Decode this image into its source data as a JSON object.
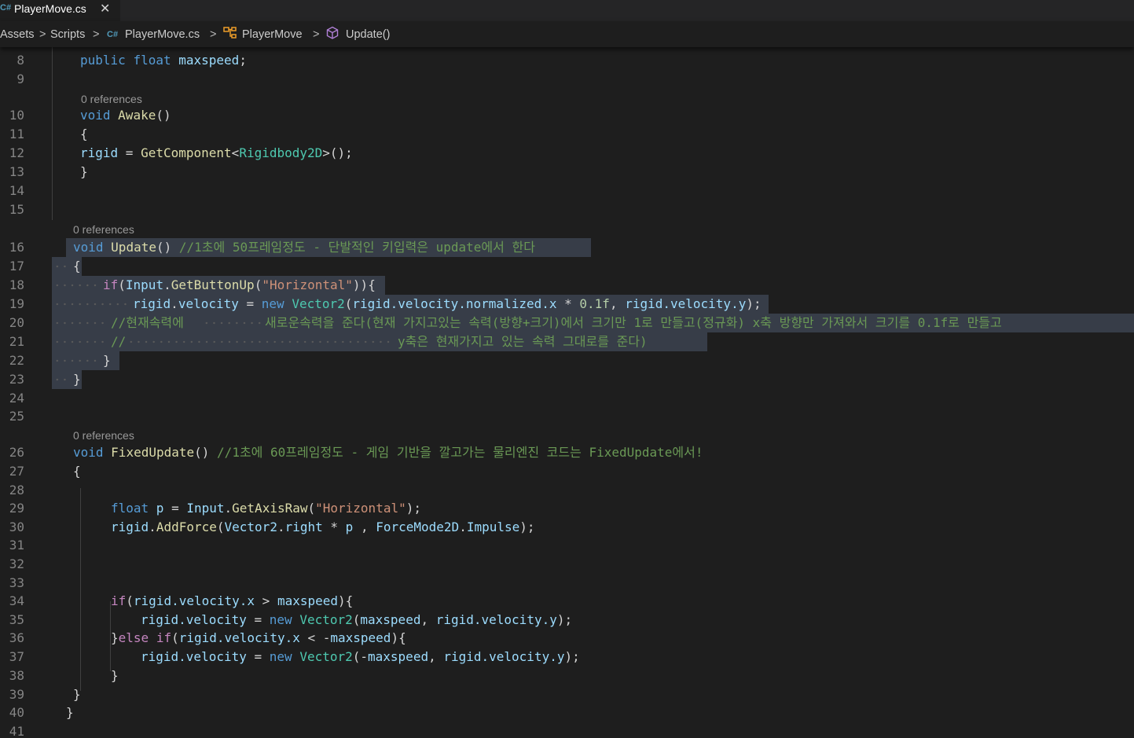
{
  "tab": {
    "label": "PlayerMove.cs",
    "close_glyph": "✕",
    "icon": "csharp-file-icon"
  },
  "breadcrumbs": {
    "items": [
      "Assets",
      "Scripts",
      "PlayerMove.cs",
      "PlayerMove",
      "Update()"
    ],
    "separator": ">"
  },
  "codelens": [
    "0 references",
    "0 references",
    "0 references"
  ],
  "lines": [
    {
      "n": "8"
    },
    {
      "n": "9"
    },
    {
      "n": "10"
    },
    {
      "n": "11"
    },
    {
      "n": "12"
    },
    {
      "n": "13"
    },
    {
      "n": "14"
    },
    {
      "n": "15"
    },
    {
      "n": "16"
    },
    {
      "n": "17"
    },
    {
      "n": "18"
    },
    {
      "n": "19"
    },
    {
      "n": "20"
    },
    {
      "n": "21"
    },
    {
      "n": "22"
    },
    {
      "n": "23"
    },
    {
      "n": "24"
    },
    {
      "n": "25"
    },
    {
      "n": "26"
    },
    {
      "n": "27"
    },
    {
      "n": "28"
    },
    {
      "n": "29"
    },
    {
      "n": "30"
    },
    {
      "n": "31"
    },
    {
      "n": "32"
    },
    {
      "n": "33"
    },
    {
      "n": "34"
    },
    {
      "n": "35"
    },
    {
      "n": "36"
    },
    {
      "n": "37"
    },
    {
      "n": "38"
    },
    {
      "n": "39"
    },
    {
      "n": "40"
    },
    {
      "n": "41"
    }
  ],
  "code": {
    "l8": {
      "public": "public",
      "float": "float",
      "name": "maxspeed",
      "end": ";"
    },
    "l10": {
      "void": "void",
      "fn": "Awake",
      "paren": "()"
    },
    "l11": "{",
    "l12": {
      "var": "rigid",
      "eq": " = ",
      "fn": "GetComponent",
      "lt": "<",
      "ty": "Rigidbody2D",
      "rest": ">();"
    },
    "l13": "}",
    "l16": {
      "void": "void",
      "fn": "Update",
      "paren": "() ",
      "comment": "//1초에 50프레임정도 - 단발적인 키입력은 update에서 한다"
    },
    "l17": "{",
    "l18": {
      "if": "if",
      "p1": "(",
      "ty": "Input",
      "dot": ".",
      "fn": "GetButtonUp",
      "p2": "(",
      "str": "\"Horizontal\"",
      "p3": ")){"
    },
    "l19": {
      "a": "rigid",
      "b": ".",
      "c": "velocity",
      "d": " = ",
      "new": "new",
      "sp": " ",
      "ty": "Vector2",
      "e": "(",
      "f": "rigid.velocity.normalized.x",
      "g": " * ",
      "num": "0.1f",
      "h": ", ",
      "i": "rigid.velocity.y",
      "j": ");"
    },
    "l20": {
      "c1": "//현재속력에",
      "c2": "새로운속력을 준다(현재 가지고있는 속력(방향+크기)에서 크기만 1로 만들고(정규화) x축 방향만 가져와서 크기를 0.1f로 만들고"
    },
    "l21": {
      "c1": "//",
      "c2": "y축은 현재가지고 있는 속력 그대로를 준다)"
    },
    "l22": "}",
    "l23": "}",
    "l26": {
      "void": "void",
      "fn": "FixedUpdate",
      "paren": "() ",
      "comment": "//1초에 60프레임정도 - 게임 기반을 깔고가는 물리엔진 코드는 FixedUpdate에서!"
    },
    "l27": "{",
    "l29": {
      "float": "float",
      "var": " p",
      "eq": " = ",
      "ty": "Input",
      "dot": ".",
      "fn": "GetAxisRaw",
      "p": "(",
      "str": "\"Horizontal\"",
      "end": ");"
    },
    "l30": {
      "var": "rigid",
      "dot": ".",
      "fn": "AddForce",
      "p": "(",
      "ty": "Vector2",
      "d2": ".",
      "right": "right",
      "mul": " * ",
      "pv": "p",
      "comma": " , ",
      "ty2": "ForceMode2D",
      "d3": ".",
      "imp": "Impulse",
      "end": ");"
    },
    "l34": {
      "if": "if",
      "p": "(",
      "a": "rigid.velocity.x",
      "op": " > ",
      "b": "maxspeed",
      "end": "){"
    },
    "l35": {
      "a": "rigid.velocity",
      "eq": " = ",
      "new": "new",
      "sp": " ",
      "ty": "Vector2",
      "p": "(",
      "b": "maxspeed",
      "c": ", ",
      "d": "rigid.velocity.y",
      "end": ");"
    },
    "l36": {
      "brace": "}",
      "else": "else",
      "sp": " ",
      "if": "if",
      "p": "(",
      "a": "rigid.velocity.x",
      "op": " < -",
      "b": "maxspeed",
      "end": "){"
    },
    "l37": {
      "a": "rigid.velocity",
      "eq": " = ",
      "new": "new",
      "sp": " ",
      "ty": "Vector2",
      "p": "(-",
      "b": "maxspeed",
      "c": ", ",
      "d": "rigid.velocity.y",
      "end": ");"
    },
    "l38": "}",
    "l39": "}",
    "l40": "}"
  },
  "colors": {
    "background": "#1e1e1e",
    "keyword": "#569cd6",
    "control": "#c586c0",
    "type": "#4ec9b0",
    "function": "#dcdcaa",
    "variable": "#9cdcfe",
    "string": "#ce9178",
    "number": "#b5cea8",
    "comment": "#6a9955",
    "selection": "#373d48",
    "line_number": "#858585"
  }
}
